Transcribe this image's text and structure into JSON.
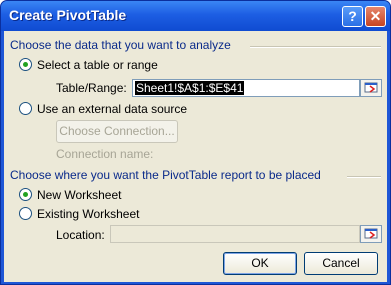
{
  "window": {
    "title": "Create PivotTable",
    "help_glyph": "?",
    "close_glyph": "✕"
  },
  "data_section": {
    "heading": "Choose the data that you want to analyze",
    "option_range": "Select a table or range",
    "table_range_label": "Table/Range:",
    "table_range_value": "Sheet1!$A$1:$E$41",
    "option_external": "Use an external data source",
    "choose_connection": "Choose Connection...",
    "connection_name_label": "Connection name:"
  },
  "placement_section": {
    "heading": "Choose where you want the PivotTable report to be placed",
    "option_new": "New Worksheet",
    "option_existing": "Existing Worksheet",
    "location_label": "Location:",
    "location_value": ""
  },
  "buttons": {
    "ok": "OK",
    "cancel": "Cancel"
  },
  "icons": {
    "collapse": "collapse-dialog-icon"
  }
}
